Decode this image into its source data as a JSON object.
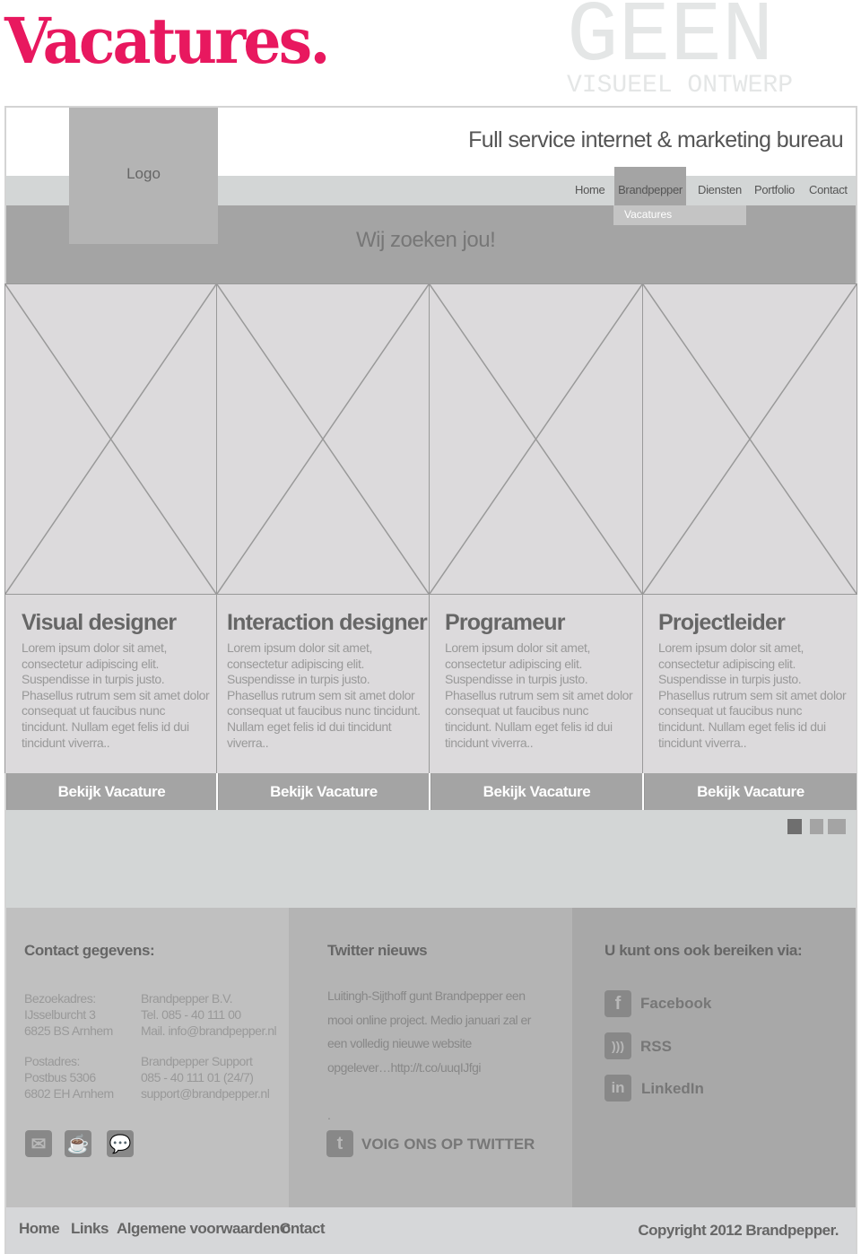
{
  "page_title": "Vacatures.",
  "watermark": {
    "line1": "GEEN",
    "line2": "VISUEEL ONTWERP"
  },
  "header": {
    "logo": "Logo",
    "tagline": "Full service internet & marketing bureau",
    "nav": [
      "Home",
      "Brandpepper",
      "Diensten",
      "Portfolio",
      "Contact"
    ],
    "active_nav": "Brandpepper",
    "dropdown": [
      "Vacatures"
    ],
    "headline": "Wij zoeken jou!"
  },
  "jobs": [
    {
      "title": "Visual designer",
      "text": "Lorem ipsum dolor sit amet, consectetur adipiscing elit. Suspendisse in turpis justo. Phasellus rutrum sem sit amet dolor consequat ut faucibus nunc tincidunt. Nullam eget felis id dui tincidunt viverra..",
      "button": "Bekijk Vacature"
    },
    {
      "title": "Interaction designer",
      "text": "Lorem ipsum dolor sit amet, consectetur adipiscing elit. Suspendisse in turpis justo. Phasellus rutrum sem sit amet dolor consequat ut faucibus nunc tincidunt. Nullam eget felis id dui tincidunt viverra..",
      "button": "Bekijk Vacature"
    },
    {
      "title": "Programeur",
      "text": "Lorem ipsum dolor sit amet, consectetur adipiscing elit. Suspendisse in turpis justo. Phasellus rutrum sem sit amet dolor consequat ut faucibus nunc tincidunt. Nullam eget felis id dui tincidunt viverra..",
      "button": "Bekijk Vacature"
    },
    {
      "title": "Projectleider",
      "text": "Lorem ipsum dolor sit amet, consectetur adipiscing elit. Suspendisse in turpis justo. Phasellus rutrum sem sit amet dolor consequat ut faucibus nunc tincidunt. Nullam eget felis id dui tincidunt viverra..",
      "button": "Bekijk Vacature"
    }
  ],
  "slider": {
    "pages": 3,
    "active": 1
  },
  "footer": {
    "contact": {
      "heading": "Contact gegevens:",
      "visit_label": [
        "Bezoekadres:",
        "IJsselburcht 3",
        "6825 BS Arnhem"
      ],
      "visit_info": [
        "Brandpepper B.V.",
        "Tel. 085 - 40 111 00",
        "Mail. info@brandpepper.nl"
      ],
      "post_label": [
        "Postadres:",
        "Postbus 5306",
        "6802 EH Arnhem"
      ],
      "post_info": [
        "Brandpepper Support",
        "085 - 40 111 01 (24/7)",
        "support@brandpepper.nl"
      ],
      "icons": [
        "mail-icon",
        "coffee-icon",
        "chat-icon"
      ]
    },
    "twitter": {
      "heading": "Twitter nieuws",
      "tweet": [
        "Luitingh-Sijthoff gunt Brandpepper een",
        "mooi online project. Medio januari zal er",
        "een volledig nieuwe website",
        "opgelever…http://t.co/uuqIJfgi"
      ],
      "dot": ".",
      "follow": "VOIG ONS OP TWITTER"
    },
    "social": {
      "heading": "U kunt ons ook bereiken via:",
      "items": [
        {
          "label": "Facebook",
          "glyph": "f",
          "icon": "facebook-icon"
        },
        {
          "label": "RSS",
          "glyph": "))",
          "icon": "rss-icon"
        },
        {
          "label": "LinkedIn",
          "glyph": "in",
          "icon": "linkedin-icon"
        }
      ]
    }
  },
  "bottom": {
    "links": [
      "Home",
      "Links",
      "Algemene voorwaardenC",
      "ontact"
    ],
    "copyright": "Copyright 2012 Brandpepper."
  },
  "colors": {
    "accent": "#e8185f",
    "band": "#a4a4a4",
    "nav": "#d3d6d6"
  }
}
